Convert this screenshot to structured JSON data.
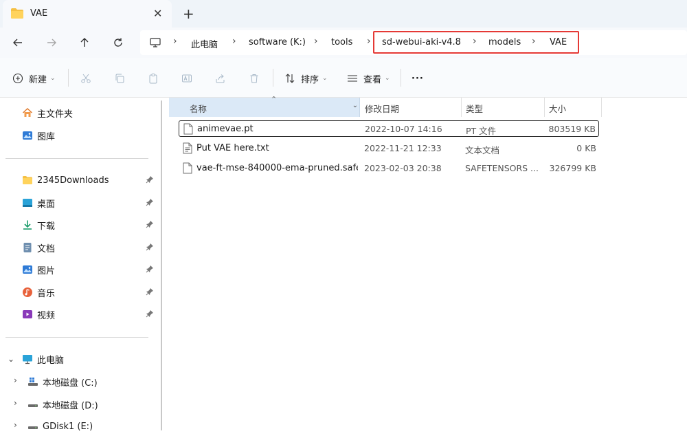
{
  "tab": {
    "title": "VAE"
  },
  "address": {
    "crumbs": [
      "此电脑",
      "software (K:)",
      "tools",
      "sd-webui-aki-v4.8",
      "models",
      "VAE"
    ]
  },
  "toolbar": {
    "new_label": "新建",
    "sort_label": "排序",
    "view_label": "查看",
    "more_label": "···"
  },
  "sidebar": {
    "home": "主文件夹",
    "gallery": "图库",
    "quick": [
      {
        "label": "2345Downloads",
        "icon": "folder-icon"
      },
      {
        "label": "桌面",
        "icon": "desktop-icon"
      },
      {
        "label": "下载",
        "icon": "download-icon"
      },
      {
        "label": "文档",
        "icon": "documents-icon"
      },
      {
        "label": "图片",
        "icon": "pictures-icon"
      },
      {
        "label": "音乐",
        "icon": "music-icon"
      },
      {
        "label": "视频",
        "icon": "videos-icon"
      }
    ],
    "this_pc": "此电脑",
    "drives": [
      "本地磁盘 (C:)",
      "本地磁盘 (D:)",
      "GDisk1 (E:)"
    ]
  },
  "columns": {
    "name": "名称",
    "modified": "修改日期",
    "type": "类型",
    "size": "大小"
  },
  "files": [
    {
      "name": "animevae.pt",
      "modified": "2022-10-07 14:16",
      "type": "PT 文件",
      "size": "803519 KB",
      "selected": true
    },
    {
      "name": "Put VAE here.txt",
      "modified": "2022-11-21 12:33",
      "type": "文本文档",
      "size": "0 KB",
      "selected": false
    },
    {
      "name": "vae-ft-mse-840000-ema-pruned.safet...",
      "modified": "2023-02-03 20:38",
      "type": "SAFETENSORS ...",
      "size": "326799 KB",
      "selected": false
    }
  ],
  "colors": {
    "highlight": "#e53935",
    "folder": "#f5c043",
    "header_sorted": "#dbe9f7"
  }
}
